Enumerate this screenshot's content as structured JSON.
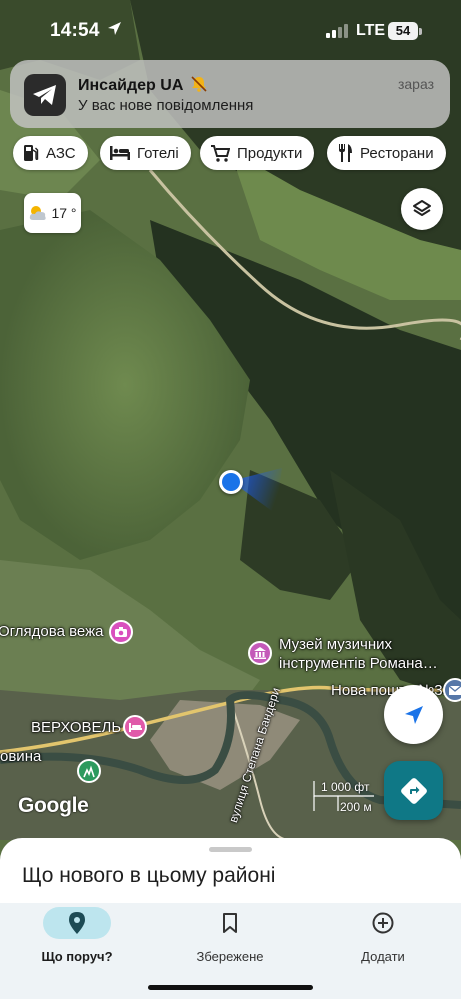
{
  "status_bar": {
    "time": "14:54",
    "network": "LTE",
    "battery": "54"
  },
  "notification": {
    "app": "Инсайдер UA",
    "message": "У вас нове повідомлення",
    "time": "зараз",
    "icon": "telegram-icon"
  },
  "chips": [
    {
      "label": "АЗС",
      "icon": "gas-station-icon"
    },
    {
      "label": "Готелі",
      "icon": "hotel-bed-icon"
    },
    {
      "label": "Продукти",
      "icon": "shopping-cart-icon"
    },
    {
      "label": "Ресторани",
      "icon": "fork-knife-icon"
    }
  ],
  "weather": {
    "temp": "17 °",
    "icon": "partly-cloudy-icon"
  },
  "map_labels": {
    "poi_tower": "Оглядова вежа",
    "poi_museum_1": "Музей музичних",
    "poi_museum_2": "інструментів Романа…",
    "poi_post": "Нова пошта №31",
    "village": "ВЕРХОВЕЛЬ",
    "village2": "овина",
    "street": "вулиця Степана Бандери",
    "attribution": "Google",
    "scale_ft": "1 000 фт",
    "scale_m": "200 м"
  },
  "sheet": {
    "title": "Що нового в цьому районі"
  },
  "tabs": [
    {
      "label": "Що поруч?",
      "icon": "location-pin-icon",
      "active": true
    },
    {
      "label": "Збережене",
      "icon": "bookmark-icon",
      "active": false
    },
    {
      "label": "Додати",
      "icon": "add-circle-icon",
      "active": false
    }
  ],
  "colors": {
    "accent": "#0f7886",
    "blue_dot": "#1a73e8",
    "active_tab": "#bde5ee"
  }
}
